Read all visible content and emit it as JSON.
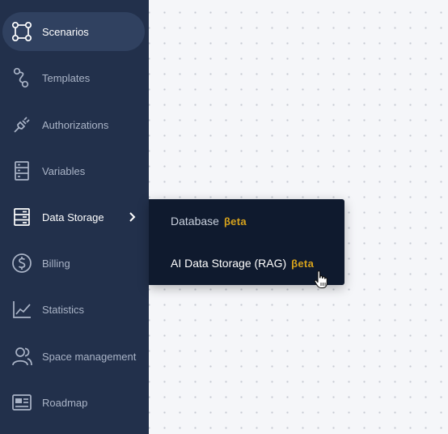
{
  "sidebar": {
    "items": [
      {
        "label": "Scenarios",
        "icon": "scenarios-icon",
        "state": "active"
      },
      {
        "label": "Templates",
        "icon": "templates-icon"
      },
      {
        "label": "Authorizations",
        "icon": "plug-icon"
      },
      {
        "label": "Variables",
        "icon": "variables-icon"
      },
      {
        "label": "Data Storage",
        "icon": "data-storage-icon",
        "state": "open"
      },
      {
        "label": "Billing",
        "icon": "dollar-icon"
      },
      {
        "label": "Statistics",
        "icon": "chart-line-icon"
      },
      {
        "label": "Space management",
        "icon": "users-icon"
      },
      {
        "label": "Roadmap",
        "icon": "roadmap-icon"
      }
    ]
  },
  "flyout": {
    "items": [
      {
        "label": "Database",
        "badge": "βeta"
      },
      {
        "label": "AI Data Storage (RAG)",
        "badge": "βeta"
      }
    ]
  },
  "colors": {
    "sidebar_bg": "#22304b",
    "active_bg": "#304160",
    "flyout_bg": "#0f1a2e",
    "badge": "#d6a21c",
    "canvas_bg": "#f5f6f9"
  }
}
